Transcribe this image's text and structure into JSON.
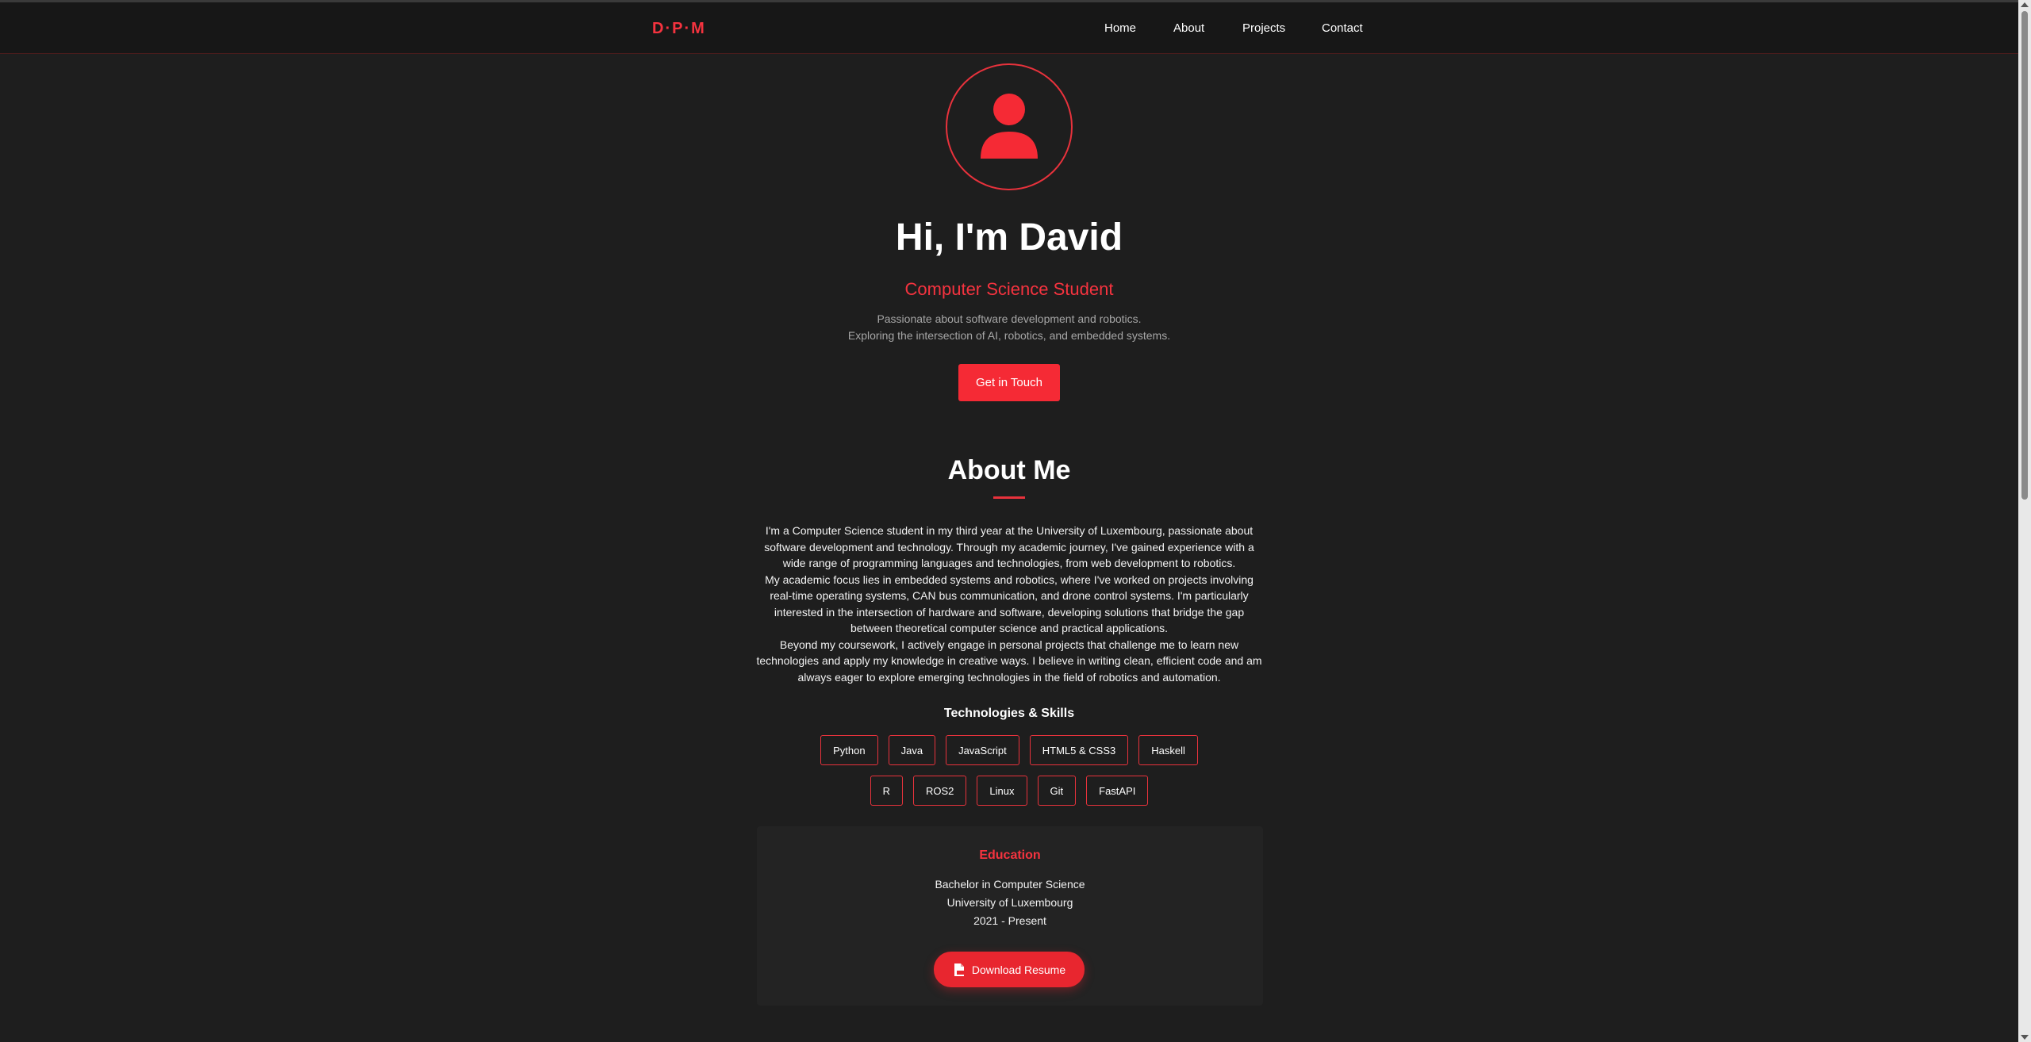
{
  "nav": {
    "logo": "D·P·M",
    "links": [
      "Home",
      "About",
      "Projects",
      "Contact"
    ]
  },
  "hero": {
    "title": "Hi, I'm David",
    "subtitle": "Computer Science Student",
    "desc_line1": "Passionate about software development and robotics.",
    "desc_line2": "Exploring the intersection of AI, robotics, and embedded systems.",
    "cta_label": "Get in Touch"
  },
  "about": {
    "title": "About Me",
    "paragraphs": [
      "I'm a Computer Science student in my third year at the University of Luxembourg, passionate about software development and technology. Through my academic journey, I've gained experience with a wide range of programming languages and technologies, from web development to robotics.",
      "My academic focus lies in embedded systems and robotics, where I've worked on projects involving real-time operating systems, CAN bus communication, and drone control systems. I'm particularly interested in the intersection of hardware and software, developing solutions that bridge the gap between theoretical computer science and practical applications.",
      "Beyond my coursework, I actively engage in personal projects that challenge me to learn new technologies and apply my knowledge in creative ways. I believe in writing clean, efficient code and am always eager to explore emerging technologies in the field of robotics and automation."
    ]
  },
  "skills": {
    "title": "Technologies & Skills",
    "row1": [
      "Python",
      "Java",
      "JavaScript",
      "HTML5 & CSS3",
      "Haskell"
    ],
    "row2": [
      "R",
      "ROS2",
      "Linux",
      "Git",
      "FastAPI"
    ]
  },
  "education": {
    "title": "Education",
    "degree": "Bachelor in Computer Science",
    "school": "University of Luxembourg",
    "years": "2021 - Present",
    "download_label": "Download Resume"
  },
  "colors": {
    "accent": "#f5333f",
    "background": "#1e1e1e",
    "nav_bg": "#171717"
  },
  "icons": {
    "avatar": "user-icon",
    "download": "file-pdf-icon"
  }
}
